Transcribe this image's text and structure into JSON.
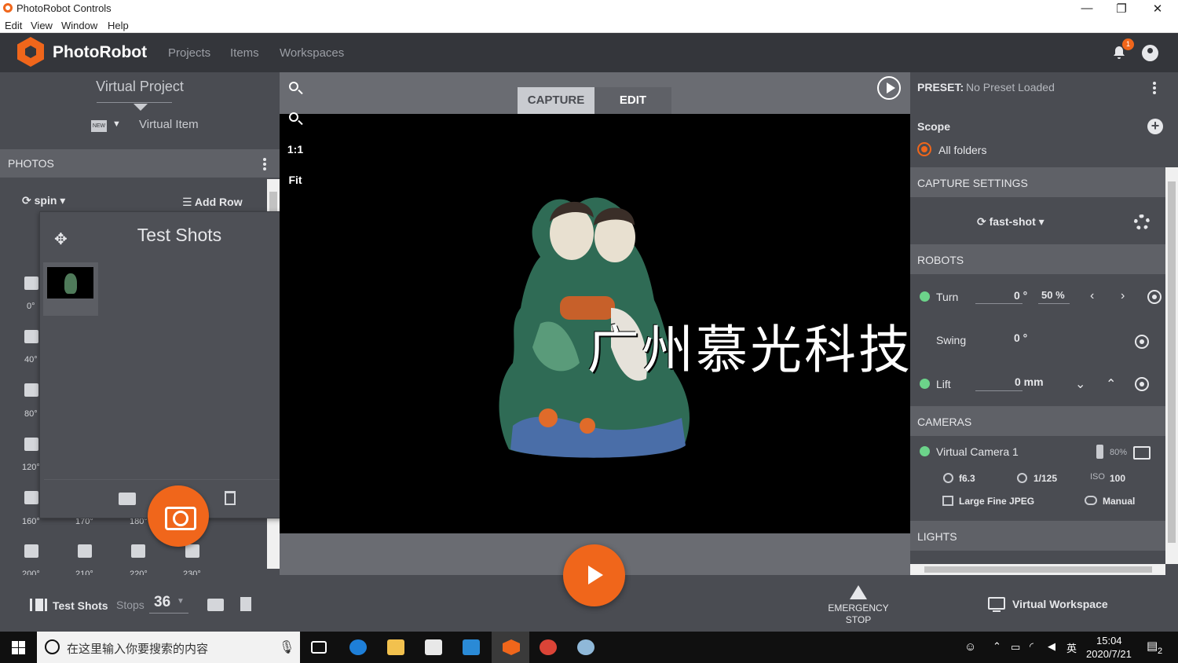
{
  "window": {
    "title": "PhotoRobot Controls"
  },
  "menu": [
    "Edit",
    "View",
    "Window",
    "Help"
  ],
  "app": {
    "brand": "PhotoRobot",
    "nav": [
      "Projects",
      "Items",
      "Workspaces"
    ],
    "notification_count": "1"
  },
  "left": {
    "project": "Virtual Project",
    "new_icon": "NEW",
    "item": "Virtual Item",
    "photos_header": "PHOTOS",
    "spin_label": "spin",
    "add_row": "Add Row",
    "degrees": [
      "0°",
      "40°",
      "80°",
      "120°",
      "160°",
      "170°",
      "180°",
      "200°",
      "210°",
      "220°",
      "230°"
    ]
  },
  "test_shots": {
    "title": "Test Shots"
  },
  "bottom": {
    "test_shots": "Test Shots",
    "stops_label": "Stops",
    "stops_value": "36",
    "emergency_line1": "EMERGENCY",
    "emergency_line2": "STOP",
    "workspace": "Virtual Workspace"
  },
  "viewer": {
    "tab_capture": "CAPTURE",
    "tab_edit": "EDIT",
    "active_tab": "CAPTURE",
    "zoom_one": "1:1",
    "zoom_fit": "Fit",
    "watermark": "广州慕光科技有限公司"
  },
  "right": {
    "preset_label": "PRESET:",
    "preset_value": "No Preset Loaded",
    "scope": "Scope",
    "all_folders": "All folders",
    "capture_settings": "CAPTURE SETTINGS",
    "capture_mode": "fast-shot",
    "robots": "ROBOTS",
    "turn": {
      "label": "Turn",
      "value": "0 °",
      "speed": "50 %"
    },
    "swing": {
      "label": "Swing",
      "value": "0 °"
    },
    "lift": {
      "label": "Lift",
      "value": "0 mm"
    },
    "cameras": "CAMERAS",
    "camera": {
      "name": "Virtual Camera 1",
      "battery": "80%",
      "aperture": "f6.3",
      "shutter": "1/125",
      "iso_label": "ISO",
      "iso": "100",
      "format": "Large Fine JPEG",
      "mode": "Manual"
    },
    "lights": "LIGHTS"
  },
  "taskbar": {
    "search_placeholder": "在这里输入你要搜索的内容",
    "time": "15:04",
    "date": "2020/7/21",
    "ime": "英",
    "notifications": "2"
  },
  "colors": {
    "accent": "#f0661b",
    "panel": "#4a4c52",
    "header": "#5f6167",
    "status_green": "#6cd38a"
  }
}
